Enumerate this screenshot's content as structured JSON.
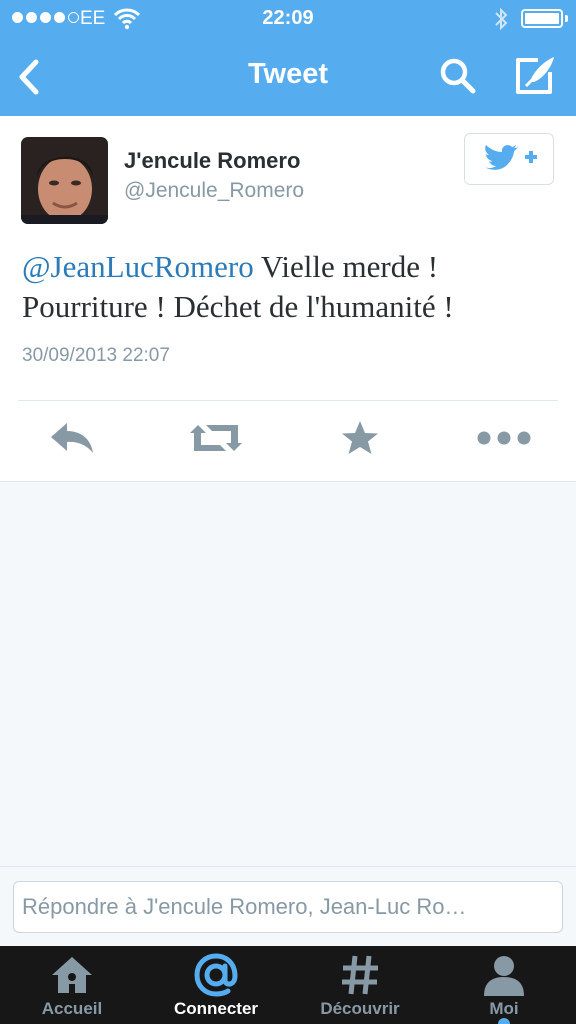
{
  "status_bar": {
    "carrier": "EE",
    "time": "22:09",
    "signal_bars": 4,
    "signal_max": 5,
    "battery_level": 1.0
  },
  "nav": {
    "title": "Tweet",
    "back_icon": "chevron-left-icon",
    "search_icon": "search-icon",
    "compose_icon": "compose-icon"
  },
  "tweet": {
    "author_name": "J'encule Romero",
    "author_handle": "@Jencule_Romero",
    "mention": "@JeanLucRomero",
    "text": " Vielle merde ! Pourriture ! Déchet de l'humanité !",
    "timestamp": "30/09/2013 22:07",
    "follow_icon": "follow-bird-plus-icon",
    "actions": [
      "reply-icon",
      "retweet-icon",
      "favorite-star-icon",
      "more-dots-icon"
    ]
  },
  "reply": {
    "placeholder": "Répondre à J'encule Romero, Jean-Luc Ro…"
  },
  "tabs": [
    {
      "label": "Accueil",
      "icon": "home-icon",
      "active": false
    },
    {
      "label": "Connecter",
      "icon": "at-icon",
      "active": true
    },
    {
      "label": "Découvrir",
      "icon": "hashtag-icon",
      "active": false
    },
    {
      "label": "Moi",
      "icon": "person-icon",
      "active": false
    }
  ],
  "colors": {
    "brand": "#55acee",
    "mention": "#2b7bb9",
    "muted_text": "#8899a6",
    "tab_bar": "#171717",
    "icon_gray": "#8899a6"
  }
}
